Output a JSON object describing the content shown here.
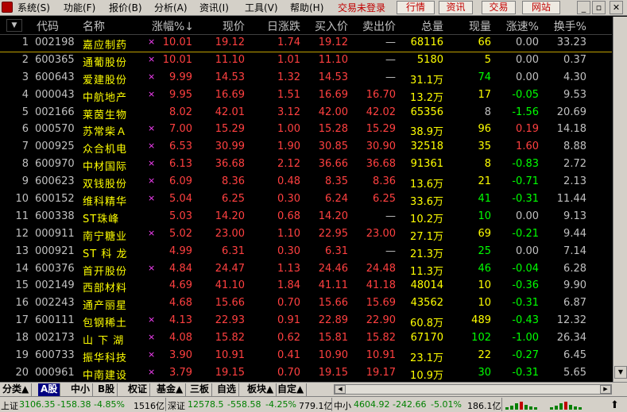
{
  "menubar": {
    "items": [
      "系统(S)",
      "功能(F)",
      "报价(B)",
      "分析(A)",
      "资讯(I)",
      "工具(V)",
      "帮助(H)"
    ],
    "status_text": "交易未登录",
    "buttons": [
      "行情",
      "资讯",
      "交易",
      "网站"
    ],
    "window_controls": [
      "minimize-icon",
      "restore-icon",
      "close-icon"
    ]
  },
  "header": {
    "columns": [
      "代码",
      "名称",
      "涨幅%↓",
      "现价",
      "日涨跌",
      "买入价",
      "卖出价",
      "总量",
      "现量",
      "涨速%",
      "换手%"
    ]
  },
  "rows": [
    {
      "num": "1",
      "code": "002198",
      "name": "嘉应制药",
      "mark": "×",
      "chg": "10.01",
      "price": "19.12",
      "dayc": "1.74",
      "bid": "19.12",
      "ask": "—",
      "vol": "68116",
      "cur": "66",
      "spd": "0.00",
      "spd_color": "w",
      "turn": "33.23"
    },
    {
      "num": "2",
      "code": "600365",
      "name": "通葡股份",
      "mark": "×",
      "chg": "10.01",
      "price": "11.10",
      "dayc": "1.01",
      "bid": "11.10",
      "ask": "—",
      "vol": "5180",
      "cur": "5",
      "spd": "0.00",
      "spd_color": "w",
      "turn": "0.37"
    },
    {
      "num": "3",
      "code": "600643",
      "name": "爱建股份",
      "mark": "×",
      "chg": "9.99",
      "price": "14.53",
      "dayc": "1.32",
      "bid": "14.53",
      "ask": "—",
      "vol": "31.1万",
      "cur": "74",
      "cur_color": "g",
      "spd": "0.00",
      "spd_color": "w",
      "turn": "4.30"
    },
    {
      "num": "4",
      "code": "000043",
      "name": "中航地产",
      "mark": "×",
      "chg": "9.95",
      "price": "16.69",
      "dayc": "1.51",
      "bid": "16.69",
      "ask": "16.70",
      "vol": "13.2万",
      "cur": "17",
      "spd": "-0.05",
      "spd_color": "g",
      "turn": "9.53"
    },
    {
      "num": "5",
      "code": "002166",
      "name": "莱茵生物",
      "mark": "",
      "chg": "8.02",
      "price": "42.01",
      "dayc": "3.12",
      "bid": "42.00",
      "ask": "42.02",
      "vol": "65356",
      "cur": "8",
      "cur_color": "w",
      "spd": "-1.56",
      "spd_color": "g",
      "turn": "20.69"
    },
    {
      "num": "6",
      "code": "000570",
      "name": "苏常柴Ａ",
      "mark": "×",
      "chg": "7.00",
      "price": "15.29",
      "dayc": "1.00",
      "bid": "15.28",
      "ask": "15.29",
      "vol": "38.9万",
      "cur": "96",
      "spd": "0.19",
      "spd_color": "rd",
      "turn": "14.18"
    },
    {
      "num": "7",
      "code": "000925",
      "name": "众合机电",
      "mark": "×",
      "chg": "6.53",
      "price": "30.99",
      "dayc": "1.90",
      "bid": "30.85",
      "ask": "30.90",
      "vol": "32518",
      "cur": "35",
      "spd": "1.60",
      "spd_color": "rd",
      "turn": "8.88"
    },
    {
      "num": "8",
      "code": "600970",
      "name": "中材国际",
      "mark": "×",
      "chg": "6.13",
      "price": "36.68",
      "dayc": "2.12",
      "bid": "36.66",
      "ask": "36.68",
      "vol": "91361",
      "cur": "8",
      "spd": "-0.83",
      "spd_color": "g",
      "turn": "2.72"
    },
    {
      "num": "9",
      "code": "600623",
      "name": "双钱股份",
      "mark": "×",
      "chg": "6.09",
      "price": "8.36",
      "dayc": "0.48",
      "bid": "8.35",
      "ask": "8.36",
      "vol": "13.6万",
      "cur": "21",
      "spd": "-0.71",
      "spd_color": "g",
      "turn": "2.13"
    },
    {
      "num": "10",
      "code": "600152",
      "name": "维科精华",
      "mark": "×",
      "chg": "5.04",
      "price": "6.25",
      "dayc": "0.30",
      "bid": "6.24",
      "ask": "6.25",
      "vol": "33.6万",
      "cur": "41",
      "cur_color": "g",
      "spd": "-0.31",
      "spd_color": "g",
      "turn": "11.44"
    },
    {
      "num": "11",
      "code": "600338",
      "name": "ST珠峰",
      "mark": "",
      "chg": "5.03",
      "price": "14.20",
      "dayc": "0.68",
      "bid": "14.20",
      "ask": "—",
      "vol": "10.2万",
      "cur": "10",
      "cur_color": "g",
      "spd": "0.00",
      "spd_color": "w",
      "turn": "9.13"
    },
    {
      "num": "12",
      "code": "000911",
      "name": "南宁糖业",
      "mark": "×",
      "chg": "5.02",
      "price": "23.00",
      "dayc": "1.10",
      "bid": "22.95",
      "ask": "23.00",
      "vol": "27.1万",
      "cur": "69",
      "spd": "-0.21",
      "spd_color": "g",
      "turn": "9.44"
    },
    {
      "num": "13",
      "code": "000921",
      "name": "ST 科 龙",
      "mark": "",
      "chg": "4.99",
      "price": "6.31",
      "dayc": "0.30",
      "bid": "6.31",
      "ask": "—",
      "vol": "21.3万",
      "cur": "25",
      "cur_color": "g",
      "spd": "0.00",
      "spd_color": "w",
      "turn": "7.14"
    },
    {
      "num": "14",
      "code": "600376",
      "name": "首开股份",
      "mark": "×",
      "chg": "4.84",
      "price": "24.47",
      "dayc": "1.13",
      "bid": "24.46",
      "ask": "24.48",
      "vol": "11.3万",
      "cur": "46",
      "cur_color": "g",
      "spd": "-0.04",
      "spd_color": "g",
      "turn": "6.28"
    },
    {
      "num": "15",
      "code": "002149",
      "name": "西部材料",
      "mark": "",
      "chg": "4.69",
      "price": "41.10",
      "dayc": "1.84",
      "bid": "41.11",
      "ask": "41.18",
      "vol": "48014",
      "cur": "10",
      "spd": "-0.36",
      "spd_color": "g",
      "turn": "9.90"
    },
    {
      "num": "16",
      "code": "002243",
      "name": "通产丽星",
      "mark": "",
      "chg": "4.68",
      "price": "15.66",
      "dayc": "0.70",
      "bid": "15.66",
      "ask": "15.69",
      "vol": "43562",
      "cur": "10",
      "spd": "-0.31",
      "spd_color": "g",
      "turn": "6.87"
    },
    {
      "num": "17",
      "code": "600111",
      "name": "包钢稀土",
      "mark": "×",
      "chg": "4.13",
      "price": "22.93",
      "dayc": "0.91",
      "bid": "22.89",
      "ask": "22.90",
      "vol": "60.8万",
      "cur": "489",
      "spd": "-0.43",
      "spd_color": "g",
      "turn": "12.32"
    },
    {
      "num": "18",
      "code": "002173",
      "name": "山 下 湖",
      "mark": "×",
      "chg": "4.08",
      "price": "15.82",
      "dayc": "0.62",
      "bid": "15.81",
      "ask": "15.82",
      "vol": "67170",
      "cur": "102",
      "cur_color": "g",
      "spd": "-1.00",
      "spd_color": "g",
      "turn": "26.34"
    },
    {
      "num": "19",
      "code": "600733",
      "name": "振华科技",
      "mark": "×",
      "chg": "3.90",
      "price": "10.91",
      "dayc": "0.41",
      "bid": "10.90",
      "ask": "10.91",
      "vol": "23.1万",
      "cur": "22",
      "spd": "-0.27",
      "spd_color": "g",
      "turn": "6.45"
    },
    {
      "num": "20",
      "code": "000961",
      "name": "中南建设",
      "mark": "×",
      "chg": "3.79",
      "price": "19.15",
      "dayc": "0.70",
      "bid": "19.15",
      "ask": "19.17",
      "vol": "10.9万",
      "cur": "30",
      "cur_color": "g",
      "spd": "-0.31",
      "spd_color": "g",
      "turn": "5.65"
    }
  ],
  "tabs": [
    "分类▲",
    "A股",
    "中小",
    "B股",
    "权证",
    "基金▲",
    "三板",
    "自选",
    "板块▲",
    "自定▲"
  ],
  "active_tab": "A股",
  "status": {
    "sh_label": "上证",
    "sh_index": "3106.35",
    "sh_change": "-158.38",
    "sh_pct": "-4.85%",
    "sh_amount": "1516亿",
    "sz_label": "深证",
    "sz_index": "12578.5",
    "sz_change": "-558.58",
    "sz_pct": "-4.25%",
    "sz_amount": "779.1亿",
    "zx_label": "中小",
    "zx_index": "4604.92",
    "zx_change": "-242.66",
    "zx_pct": "-5.01%",
    "zx_amount": "186.1亿"
  },
  "colors": {
    "up": "#ff4040",
    "down": "#00ff00",
    "name": "#ffff00",
    "neutral": "#c0c0c0",
    "active_tab": "#000080"
  }
}
